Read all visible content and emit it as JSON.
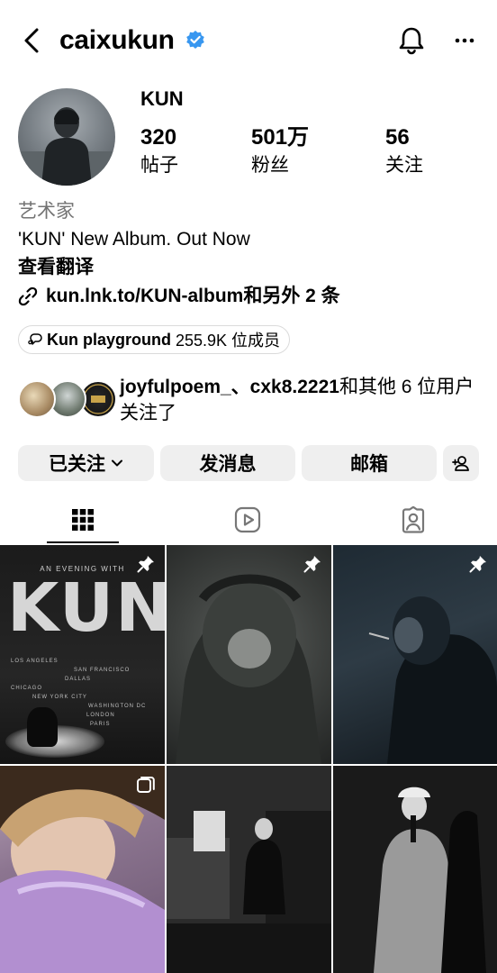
{
  "header": {
    "username": "caixukun",
    "back_icon": "chevron-left-icon",
    "verified_icon": "verified-badge-icon",
    "bell_icon": "bell-icon",
    "more_icon": "more-horizontal-icon",
    "verified_color": "#3897f0"
  },
  "profile": {
    "display_name": "KUN",
    "stats": [
      {
        "value": "320",
        "label": "帖子"
      },
      {
        "value": "501万",
        "label": "粉丝"
      },
      {
        "value": "56",
        "label": "关注"
      }
    ],
    "category": "艺术家",
    "bio": "'KUN' New Album. Out Now",
    "translate_label": "查看翻译",
    "link_text": "kun.lnk.to/KUN-album和另外 2 条",
    "channel": {
      "name": "Kun playground",
      "count": "255.9K 位成员"
    },
    "mutuals": {
      "names": "joyfulpoem_、cxk8.2221",
      "rest": "和其他 6 位用户关注了"
    }
  },
  "actions": {
    "following_label": "已关注",
    "message_label": "发消息",
    "email_label": "邮箱"
  },
  "tabs": [
    {
      "icon": "grid-icon",
      "active": true
    },
    {
      "icon": "reels-icon",
      "active": false
    },
    {
      "icon": "tagged-icon",
      "active": false
    }
  ],
  "posts": {
    "poster": {
      "top": "AN EVENING WITH",
      "title": "KUN",
      "cities": [
        "LOS ANGELES",
        "SAN FRANCISCO",
        "DALLAS",
        "CHICAGO",
        "NEW YORK CITY",
        "WASHINGTON DC",
        "LONDON",
        "PARIS"
      ]
    },
    "pinned_count": 3
  }
}
